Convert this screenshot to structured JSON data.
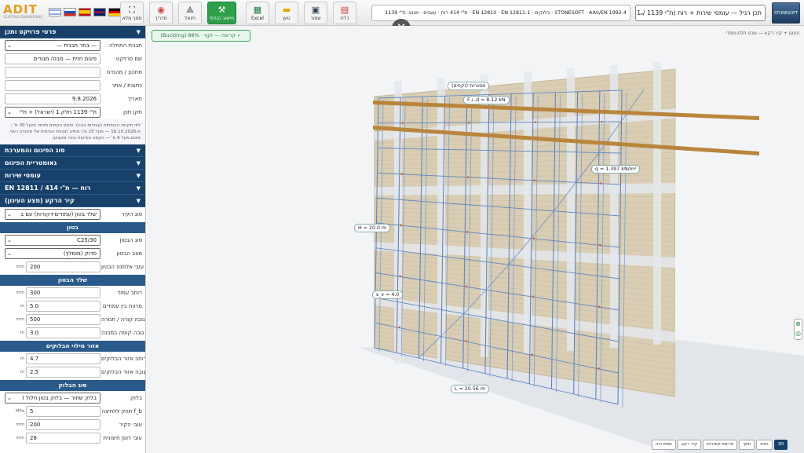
{
  "topbar": {
    "logo_text": "ADIT",
    "logo_sub": "SCAFFOLD ENGINEERING",
    "flags": [
      "israel-flag",
      "russia-flag",
      "spain-flag",
      "uk-flag",
      "germany-flag"
    ],
    "buttons": [
      {
        "name": "notes",
        "label": "מסך מלא",
        "icon": "fullscreen-icon"
      },
      {
        "name": "guide",
        "label": "מדריך",
        "icon": "guide-icon"
      },
      {
        "name": "drawings",
        "label": "ויזואל",
        "icon": "drawing-icon"
      },
      {
        "name": "structural-calc",
        "label": "חישוב הנדסי",
        "icon": "calc-icon"
      },
      {
        "name": "excel",
        "label": "Excel",
        "icon": "excel-icon"
      },
      {
        "name": "load",
        "label": "טען",
        "icon": "folder-icon"
      },
      {
        "name": "save",
        "label": "שמור",
        "icon": "save-icon"
      },
      {
        "name": "report",
        "label": "דו\"ח",
        "icon": "pdf-icon"
      }
    ],
    "standards": "STONESOFT · AAS/EN 1992-4 · בלוקים · EN 12810 · EN 12811-1 · ת\"י 414 רוח · עוגנים · מנוע: ת\"י 1139",
    "standard_select": "תכן רגיל — עומסי שירות + רוח (ת\"י 1139 / 1",
    "product_logo": "STONESOFT",
    "close": "✕"
  },
  "panel": {
    "sections_top": {
      "project": "פרטי פרויקט ותכן"
    },
    "project_rows": [
      {
        "label": "תבנית התחלה",
        "value": "— בחר תבנית —",
        "type": "select"
      },
      {
        "label": "שם פרויקט",
        "value": "פיגום חזית — מבנה מגורים",
        "type": "text"
      },
      {
        "label": "מתכנן / מהנדס",
        "value": "",
        "type": "text"
      },
      {
        "label": "כתובת / אתר",
        "value": "",
        "type": "text"
      },
      {
        "label": "תאריך",
        "value": "9.8.2026",
        "type": "text"
      },
      {
        "label": "תקן תכן",
        "value": "ת\"י 1139 חלק 1 (ישראל) + ת\"י",
        "type": "select"
      }
    ],
    "note": "לפי תקנות הבטיחות (עבודות בניה): פיגום הקמים מיוחד (מעל 30 מ' ; מ-16.10.2026 — מעל 25 מ') מחייב תוכנית הנדסית של מהנדס רשוי. פיגום מעל 6 מ' — הקמה בפיקוח בונה מקצועי.",
    "collapsed_sections": [
      "סוג הפיגום והמערכת",
      "גאומטריית הפיגום",
      "עומסי שירות",
      "רוח — ת\"י 414 / EN 12811"
    ],
    "wall_section": "קיר הרקע (מצע העיגון)",
    "wall_type": {
      "label": "סוג הקיר",
      "value": "שלד בטון (עמודים+קורות) עם ב"
    },
    "concrete_sub": "בטון",
    "concrete_rows": [
      {
        "label": "סוג הבטון",
        "value": "C25/30",
        "unit": "",
        "type": "select"
      },
      {
        "label": "מצב הבטון",
        "value": "סדוק (מומלץ)",
        "unit": "",
        "type": "select"
      },
      {
        "label": "עובי אלמנט הבטון",
        "value": "200",
        "unit": "mm",
        "type": "num"
      }
    ],
    "frame_sub": "שלד הבטון",
    "frame_rows": [
      {
        "label": "רוחב עמוד",
        "value": "300",
        "unit": "mm"
      },
      {
        "label": "מרווח בין עמודים",
        "value": "5.0",
        "unit": "m"
      },
      {
        "label": "גובה קורה / חגורה",
        "value": "500",
        "unit": "mm"
      },
      {
        "label": "גובה קומה במבנה",
        "value": "3.0",
        "unit": "m"
      }
    ],
    "infill_sub": "אזור מילוי הבלוקים",
    "infill_rows": [
      {
        "label": "רוחב אזור הבלוקים",
        "value": "4.7",
        "unit": "m"
      },
      {
        "label": "גובה אזור הבלוקים",
        "value": "2.5",
        "unit": "m"
      }
    ],
    "block_sub": "סוג הבלוק",
    "block_rows": [
      {
        "label": "בלוק",
        "value": "בלוק שחור — בלוק בטון חלול (",
        "unit": "",
        "type": "select"
      },
      {
        "label": "חוזק ללחיצה f_b",
        "value": "5",
        "unit": "MPa",
        "type": "num"
      },
      {
        "label": "עובי הקיר",
        "value": "200",
        "unit": "mm",
        "type": "num"
      },
      {
        "label": "עובי דופן חיצונית",
        "value": "28",
        "unit": "mm",
        "type": "num"
      }
    ]
  },
  "view": {
    "buckling": "(Buckling) קריסה — זקף · 88% ✓",
    "breadcrumb": "פיגום + קיר רקע — מבט תלת-ממדי",
    "labels": {
      "top": "מסגרות (זקפים)",
      "force": "F⊥,d = 8.12 kN",
      "q": "q = 1.397 kN/m²",
      "height": "H = 20.0 m",
      "sv": "s_v = 4.0",
      "length": "L = 20.56 m"
    },
    "tabs": [
      "3D",
      "חזית",
      "חתך",
      "פריסת קשירות",
      "קיר רקע",
      "מפת רוח"
    ],
    "active_tab": "3D"
  },
  "colors": {
    "navy": "#17406a",
    "green": "#2e9f4a",
    "scaffold": "#5d87c4",
    "brick": "#d9cdb4"
  }
}
